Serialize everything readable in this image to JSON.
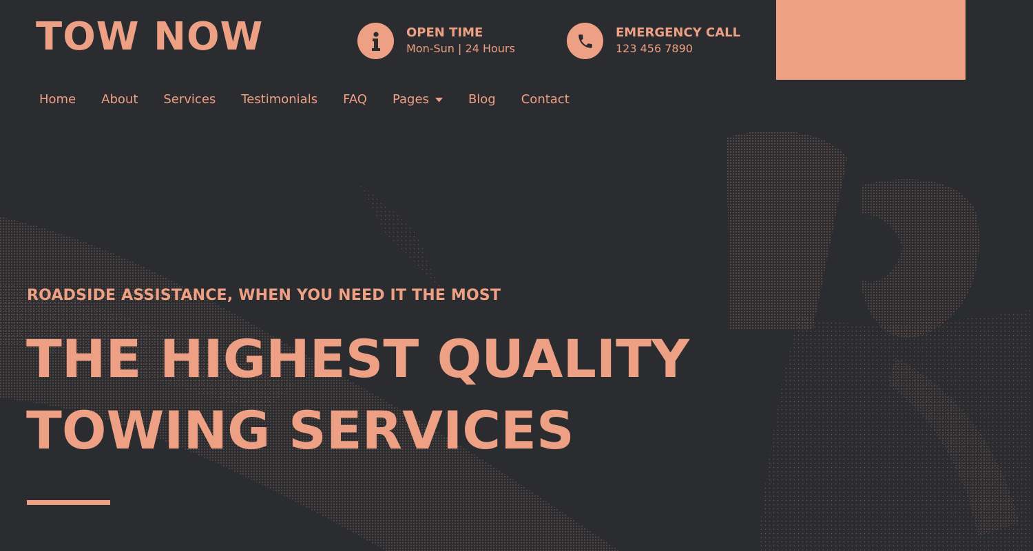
{
  "brand": {
    "logo_text": "TOW NOW"
  },
  "header": {
    "open_time": {
      "title": "OPEN TIME",
      "detail": "Mon-Sun | 24 Hours",
      "icon": "info-icon"
    },
    "emergency": {
      "title": "EMERGENCY CALL",
      "detail": "123 456 7890",
      "icon": "phone-icon"
    }
  },
  "nav": {
    "items": [
      {
        "label": "Home"
      },
      {
        "label": "About"
      },
      {
        "label": "Services"
      },
      {
        "label": "Testimonials"
      },
      {
        "label": "FAQ"
      },
      {
        "label": "Pages"
      },
      {
        "label": "Blog"
      },
      {
        "label": "Contact"
      }
    ]
  },
  "hero": {
    "eyebrow": "ROADSIDE ASSISTANCE, WHEN YOU NEED IT THE MOST",
    "headline_line1": "THE HIGHEST QUALITY",
    "headline_line2": "TOWING SERVICES"
  },
  "colors": {
    "background": "#2a2c30",
    "accent": "#eea084"
  }
}
